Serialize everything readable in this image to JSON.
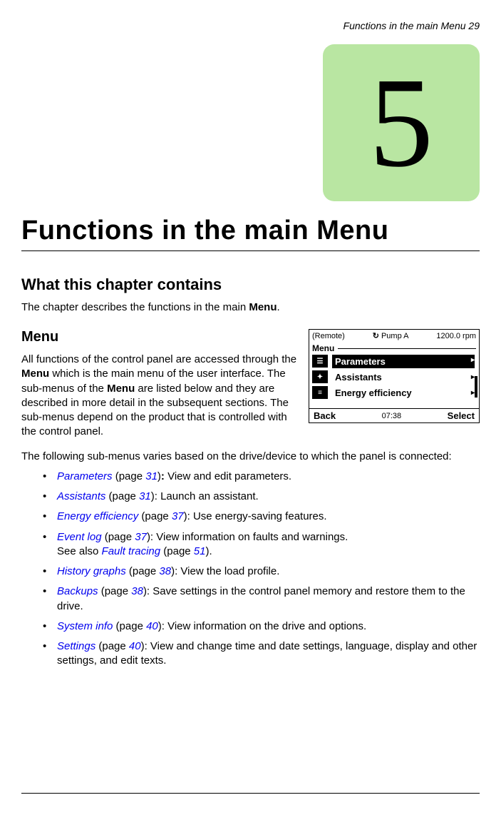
{
  "header": {
    "running_head": "Functions in the main Menu   29"
  },
  "chapter": {
    "number": "5",
    "title": "Functions in the main Menu"
  },
  "section": {
    "title": "What this chapter contains",
    "intro_prefix": "The chapter describes the functions in the main ",
    "intro_bold": "Menu",
    "intro_suffix": "."
  },
  "menu": {
    "heading": "Menu",
    "body_p1_a": "All functions of the control panel are accessed through the ",
    "body_p1_b": "Menu",
    "body_p1_c": " which is the main menu of the user interface. The sub-menus of the ",
    "body_p1_d": "Menu",
    "body_p1_e": " are listed below and they are described in more detail in the subsequent sections. The sub-menus depend on the product that is controlled with the control panel.",
    "submenu_intro": "The following sub-menus varies based on the drive/device to which the panel is connected:"
  },
  "panel": {
    "remote": "(Remote)",
    "drive_name": "Pump A",
    "rpm": "1200.0 rpm",
    "menu_label": "Menu",
    "items": [
      {
        "label": "Parameters",
        "selected": true
      },
      {
        "label": "Assistants",
        "selected": false
      },
      {
        "label": "Energy efficiency",
        "selected": false
      }
    ],
    "back": "Back",
    "time": "07:38",
    "select": "Select"
  },
  "bullets": [
    {
      "link": "Parameters",
      "page": "31",
      "suffix_bold": ":",
      "rest": " View and edit parameters."
    },
    {
      "link": "Assistants",
      "page": "31",
      "rest": "): Launch an assistant."
    },
    {
      "link": "Energy efficiency",
      "page": "37",
      "rest": "): Use energy-saving features."
    },
    {
      "link": "Event log",
      "page": "37",
      "rest": "): View information on faults and warnings.",
      "extra_prefix": "See also ",
      "extra_link": "Fault tracing",
      "extra_page": "51",
      "extra_suffix": ")."
    },
    {
      "link": "History graphs",
      "page": "38",
      "rest": "): View the load profile."
    },
    {
      "link": "Backups",
      "page": "38",
      "rest": "): Save settings in the control panel memory and restore them to the drive."
    },
    {
      "link": "System info",
      "page": "40",
      "rest": "): View information on the drive and options."
    },
    {
      "link": "Settings",
      "page": "40",
      "rest": "): View and change time and date settings, language, display and other settings, and edit texts."
    }
  ]
}
